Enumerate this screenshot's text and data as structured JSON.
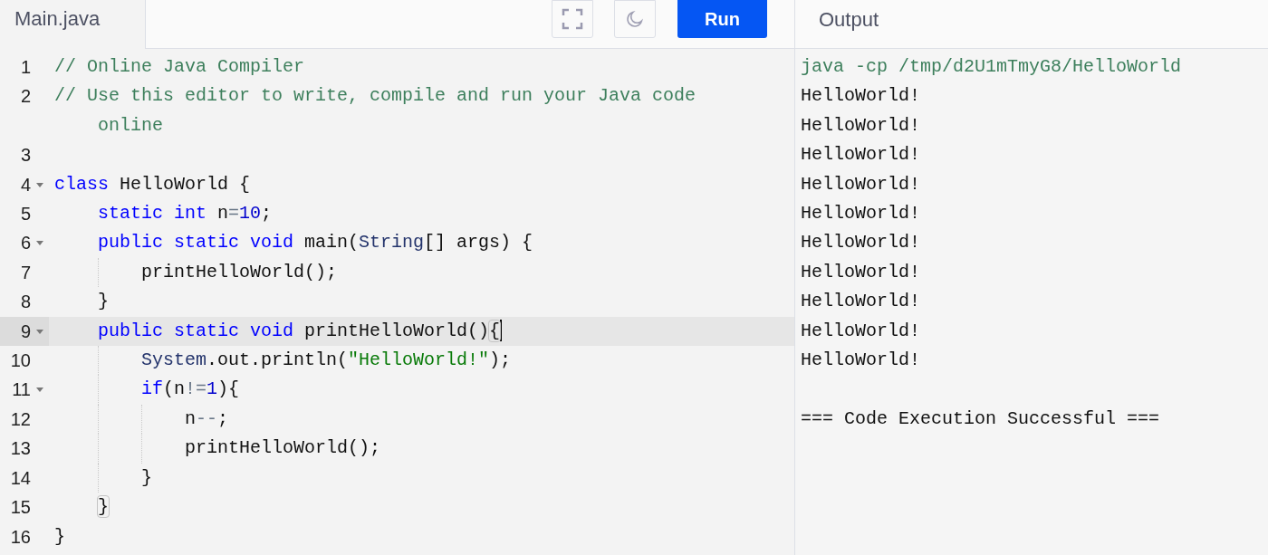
{
  "editor_tab": {
    "label": "Main.java"
  },
  "toolbar": {
    "run_label": "Run"
  },
  "output_tab": {
    "label": "Output"
  },
  "code_lines": [
    {
      "number": "1",
      "foldable": false,
      "active": false,
      "cursor": false,
      "tokens": [
        {
          "kind": "comment",
          "text": "// Online Java Compiler"
        }
      ]
    },
    {
      "number": "2",
      "foldable": false,
      "active": false,
      "cursor": false,
      "tokens": [
        {
          "kind": "comment",
          "text": "// Use this editor to write, compile and run your Java code"
        }
      ],
      "continuation": [
        {
          "kind": "comment",
          "text": "online"
        }
      ]
    },
    {
      "number": "3",
      "foldable": false,
      "active": false,
      "cursor": false
    },
    {
      "number": "4",
      "foldable": true,
      "active": false,
      "cursor": false,
      "tokens": [
        {
          "kind": "keyword",
          "text": "class"
        },
        {
          "kind": "plain",
          "text": " HelloWorld {"
        }
      ],
      "children": [
        {
          "number": "5",
          "foldable": false,
          "active": false,
          "cursor": false,
          "tokens": [
            {
              "kind": "keyword",
              "text": "static"
            },
            {
              "kind": "keyword",
              "text": " int"
            },
            {
              "kind": "plain",
              "text": " n"
            },
            {
              "kind": "operator",
              "text": "="
            },
            {
              "kind": "number",
              "text": "10"
            },
            {
              "kind": "plain",
              "text": ";"
            }
          ]
        },
        {
          "number": "6",
          "foldable": true,
          "active": false,
          "cursor": false,
          "tokens": [
            {
              "kind": "keyword",
              "text": "public"
            },
            {
              "kind": "keyword",
              "text": " static"
            },
            {
              "kind": "keyword",
              "text": " void"
            },
            {
              "kind": "plain",
              "text": " main("
            },
            {
              "kind": "type",
              "text": "String"
            },
            {
              "kind": "plain",
              "text": "[] args) {"
            }
          ],
          "children": [
            {
              "number": "7",
              "foldable": false,
              "active": false,
              "cursor": false,
              "tokens": [
                {
                  "kind": "plain",
                  "text": "printHelloWorld();"
                }
              ]
            }
          ]
        },
        {
          "number": "8",
          "foldable": false,
          "active": false,
          "cursor": false,
          "tokens": [
            {
              "kind": "plain",
              "text": "}"
            }
          ]
        },
        {
          "number": "9",
          "foldable": true,
          "active": true,
          "cursor": true,
          "tokens": [
            {
              "kind": "keyword",
              "text": "public"
            },
            {
              "kind": "keyword",
              "text": " static"
            },
            {
              "kind": "keyword",
              "text": " void"
            },
            {
              "kind": "plain",
              "text": " printHelloWorld()"
            },
            {
              "kind": "bracket-match",
              "text": "{"
            }
          ],
          "children": [
            {
              "number": "10",
              "foldable": false,
              "active": false,
              "cursor": false,
              "tokens": [
                {
                  "kind": "type",
                  "text": "System"
                },
                {
                  "kind": "plain",
                  "text": ".out.println("
                },
                {
                  "kind": "string",
                  "text": "\"HelloWorld!\""
                },
                {
                  "kind": "plain",
                  "text": ");"
                }
              ]
            },
            {
              "number": "11",
              "foldable": true,
              "active": false,
              "cursor": false,
              "tokens": [
                {
                  "kind": "keyword",
                  "text": "if"
                },
                {
                  "kind": "plain",
                  "text": "(n"
                },
                {
                  "kind": "operator",
                  "text": "!="
                },
                {
                  "kind": "number",
                  "text": "1"
                },
                {
                  "kind": "plain",
                  "text": "){"
                }
              ],
              "children": [
                {
                  "number": "12",
                  "foldable": false,
                  "active": false,
                  "cursor": false,
                  "tokens": [
                    {
                      "kind": "plain",
                      "text": "n"
                    },
                    {
                      "kind": "operator",
                      "text": "--"
                    },
                    {
                      "kind": "plain",
                      "text": ";"
                    }
                  ]
                },
                {
                  "number": "13",
                  "foldable": false,
                  "active": false,
                  "cursor": false,
                  "tokens": [
                    {
                      "kind": "plain",
                      "text": "printHelloWorld();"
                    }
                  ]
                }
              ]
            },
            {
              "number": "14",
              "foldable": false,
              "active": false,
              "cursor": false,
              "tokens": [
                {
                  "kind": "plain",
                  "text": "}"
                }
              ]
            }
          ]
        },
        {
          "number": "15",
          "foldable": false,
          "active": false,
          "cursor": false,
          "tokens": [
            {
              "kind": "bracket-match",
              "text": "}"
            }
          ]
        }
      ]
    },
    {
      "number": "16",
      "foldable": false,
      "active": false,
      "cursor": false,
      "tokens": [
        {
          "kind": "plain",
          "text": "}"
        }
      ]
    }
  ],
  "output_lines": [
    {
      "kind": "command",
      "text": "java -cp /tmp/d2U1mTmyG8/HelloWorld"
    },
    {
      "kind": "stdout",
      "text": "HelloWorld!"
    },
    {
      "kind": "stdout",
      "text": "HelloWorld!"
    },
    {
      "kind": "stdout",
      "text": "HelloWorld!"
    },
    {
      "kind": "stdout",
      "text": "HelloWorld!"
    },
    {
      "kind": "stdout",
      "text": "HelloWorld!"
    },
    {
      "kind": "stdout",
      "text": "HelloWorld!"
    },
    {
      "kind": "stdout",
      "text": "HelloWorld!"
    },
    {
      "kind": "stdout",
      "text": "HelloWorld!"
    },
    {
      "kind": "stdout",
      "text": "HelloWorld!"
    },
    {
      "kind": "stdout",
      "text": "HelloWorld!"
    },
    {
      "kind": "blank"
    },
    {
      "kind": "stdout",
      "text": "=== Code Execution Successful ==="
    }
  ]
}
